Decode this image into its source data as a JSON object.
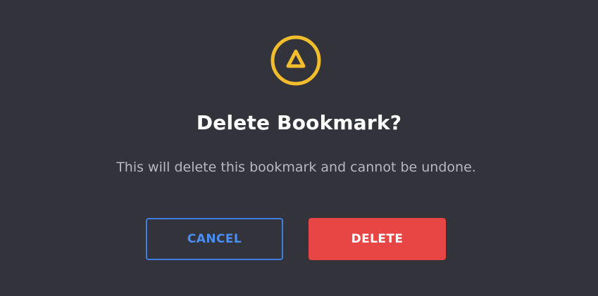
{
  "dialog": {
    "icon": "warning-triangle-icon",
    "title": "Delete Bookmark?",
    "message": "This will delete this bookmark and cannot be undone.",
    "cancel_label": "CANCEL",
    "delete_label": "DELETE"
  },
  "colors": {
    "background": "#32333b",
    "warning": "#f2bd2c",
    "cancel_accent": "#4a8ef2",
    "danger": "#e84545"
  }
}
